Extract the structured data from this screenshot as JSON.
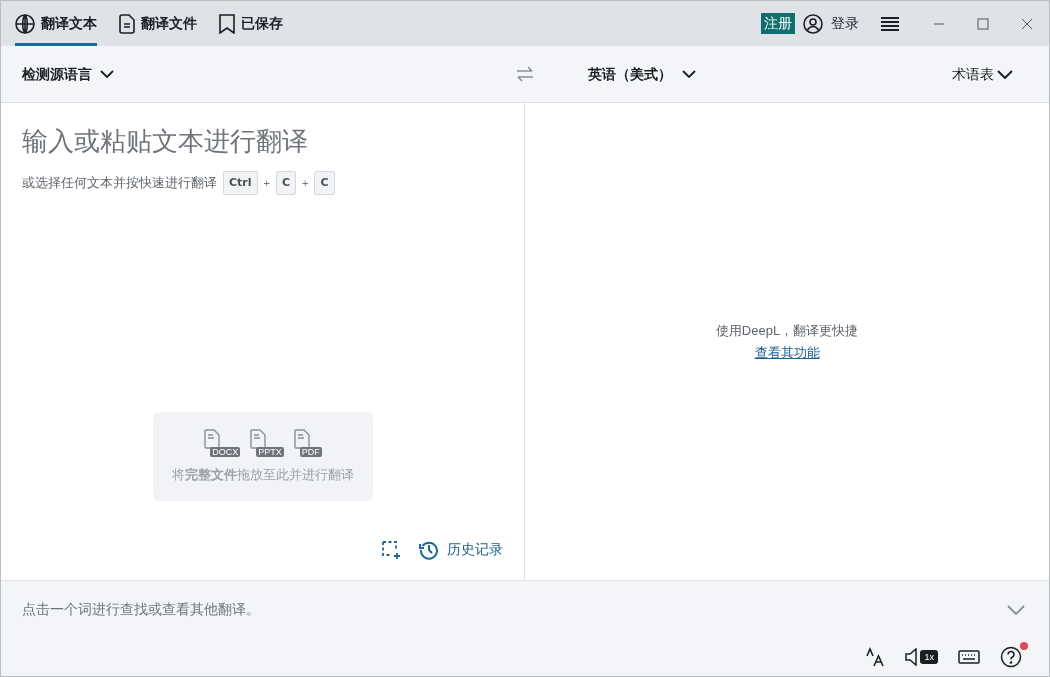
{
  "tabs": [
    {
      "label": "翻译文本",
      "kind": "globe",
      "selected": true
    },
    {
      "label": "翻译文件",
      "kind": "document",
      "selected": false
    },
    {
      "label": "已保存",
      "kind": "bookmark",
      "selected": false
    }
  ],
  "account": {
    "signup": "注册",
    "login": "登录"
  },
  "languages": {
    "source": "检测源语言",
    "target": "英语（美式）",
    "glossary": "术语表"
  },
  "source_pane": {
    "placeholder": "输入或粘贴文本进行翻译",
    "hint": "或选择任何文本并按快速进行翻译",
    "shortcut": [
      {
        "text": "Ctrl",
        "kind": "key"
      },
      {
        "text": "+",
        "kind": "plus"
      },
      {
        "text": "C",
        "kind": "key"
      },
      {
        "text": "+",
        "kind": "plus"
      },
      {
        "text": "C",
        "kind": "key"
      }
    ],
    "drop_zone": {
      "file_types": [
        "DOCX",
        "PPTX",
        "PDF"
      ],
      "text": "将**完整文件**拖放至此并进行翻译"
    },
    "history": "历史记录"
  },
  "target_pane": {
    "message": "使用DeepL，翻译更快捷",
    "link": "查看其功能"
  },
  "bottom_bar": {
    "hint": "点击一个词进行查找或查看其他翻译。",
    "speed": "1x",
    "help_notification": true
  }
}
